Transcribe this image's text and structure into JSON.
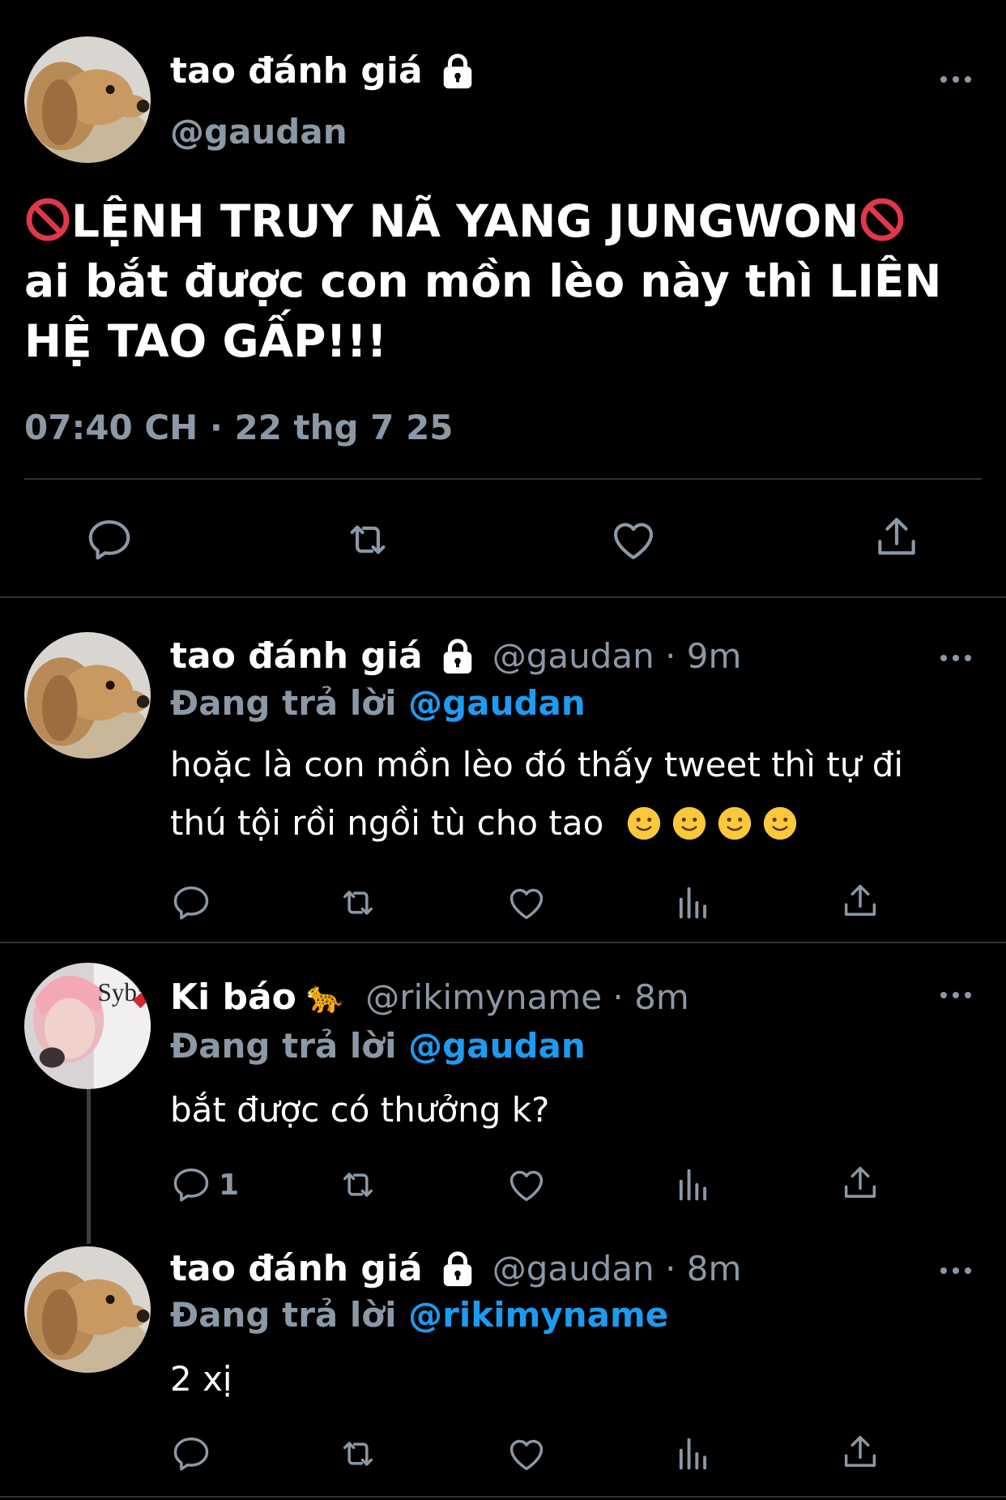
{
  "main_tweet": {
    "name": "tao đánh giá",
    "handle": "@gaudan",
    "text_line1": "LỆNH TRUY NÃ YANG JUNGWON",
    "text_rest": "ai bắt được con mồn lèo này thì LIÊN HỆ TAO GẤP!!!",
    "timestamp": "07:40 CH · 22 thg 7 25"
  },
  "replies": [
    {
      "name": "tao đánh giá",
      "handle_time": "@gaudan · 9m",
      "replying_label": "Đang trả lời ",
      "replying_to": "@gaudan",
      "text_line1": "hoặc là con mồn lèo đó thấy tweet thì tự đi",
      "text_line2": "thú tội rồi ngồi tù cho tao",
      "reply_count": ""
    },
    {
      "name": "Ki báo",
      "name_emoji": "🐆",
      "handle_time": "@rikimyname · 8m",
      "replying_label": "Đang trả lời ",
      "replying_to": "@gaudan",
      "text_line1": "bắt được có thưởng k?",
      "reply_count": "1"
    },
    {
      "name": "tao đánh giá",
      "handle_time": "@gaudan · 8m",
      "replying_label": "Đang trả lời ",
      "replying_to": "@rikimyname",
      "text_line1": "2 xị",
      "reply_count": ""
    }
  ],
  "icons": {
    "reply": "reply-icon",
    "retweet": "retweet-icon",
    "like": "like-icon",
    "analytics": "analytics-icon",
    "share": "share-icon",
    "lock": "lock-icon",
    "more": "more-icon",
    "ban": "prohibited-icon",
    "smile": "slightly-smiling-emoji"
  },
  "colors": {
    "background": "#000000",
    "secondary_text": "#8b98a5",
    "link": "#1d9bf0",
    "divider": "#2f3336"
  }
}
